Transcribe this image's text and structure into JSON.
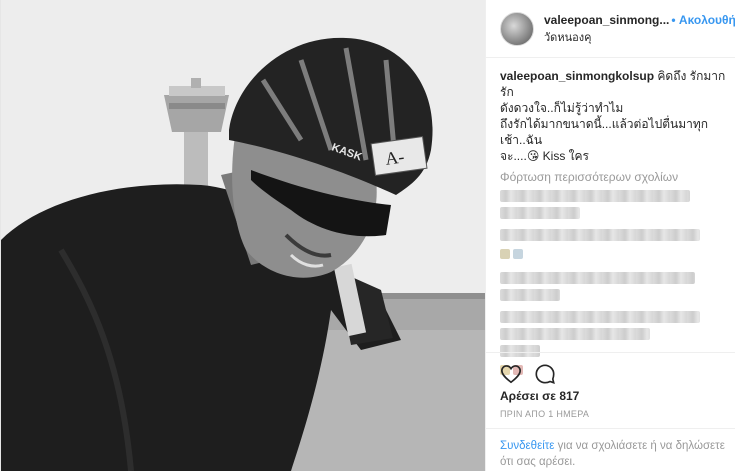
{
  "header": {
    "username": "valeepoan_sinmong...",
    "follow_label": "• Ακολουθήστε",
    "location": "วัดหนองคุ"
  },
  "caption": {
    "user": "valeepoan_sinmongkolsup",
    "line1": " คิดถึง รักมาก รัก",
    "line2": "ดังดวงใจ..ก็ไม่รู้ว่าทำไม",
    "line3": "ถึงรักได้มากขนาดนี้...แล้วต่อไปตื่นมาทุกเช้า..ฉัน",
    "line4": "จะ....😘 Kiss ใคร"
  },
  "comments": {
    "load_more": "Φόρτωση περισσότερων σχολίων"
  },
  "actions": {
    "like_icon": "heart-icon",
    "comment_icon": "comment-bubble-icon",
    "likes": "Αρέσει σε 817",
    "time": "ΠΡΙΝ ΑΠΟ 1 ΗΜΕΡΑ"
  },
  "login": {
    "link": "Συνδεθείτε",
    "text": " για να σχολιάσετε ή να δηλώσετε ότι σας αρέσει."
  },
  "colors": {
    "link_blue": "#3897f0",
    "text": "#262626",
    "muted": "#999999"
  }
}
